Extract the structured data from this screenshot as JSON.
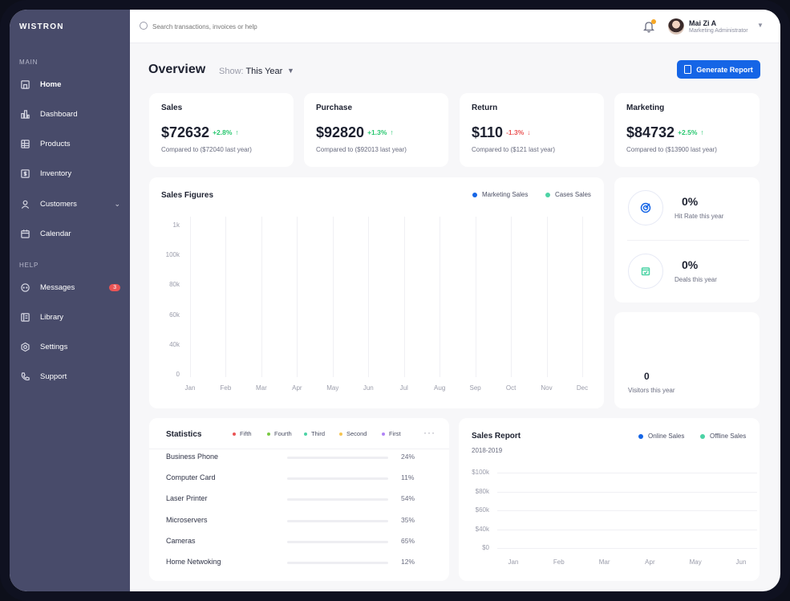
{
  "brand": "WISTRON",
  "sidebar": {
    "main_label": "MAIN",
    "help_label": "HELP",
    "main_items": [
      {
        "label": "Home",
        "icon": "home-icon"
      },
      {
        "label": "Dashboard",
        "icon": "bar-chart-icon"
      },
      {
        "label": "Products",
        "icon": "table-icon"
      },
      {
        "label": "Inventory",
        "icon": "dollar-doc-icon"
      },
      {
        "label": "Customers",
        "icon": "user-icon"
      },
      {
        "label": "Calendar",
        "icon": "calendar-icon"
      }
    ],
    "help_items": [
      {
        "label": "Messages",
        "icon": "chat-icon",
        "badge": "3"
      },
      {
        "label": "Library",
        "icon": "book-icon"
      },
      {
        "label": "Settings",
        "icon": "gear-icon"
      },
      {
        "label": "Support",
        "icon": "phone-icon"
      }
    ]
  },
  "topbar": {
    "search_placeholder": "Search transactions, invoices or help",
    "user_name": "Mai Zi A",
    "user_role": "Marketing Administrator"
  },
  "header": {
    "title": "Overview",
    "show_label": "Show:",
    "show_value": "This Year",
    "generate_button": "Generate Report"
  },
  "kpis": [
    {
      "title": "Sales",
      "value": "$72632",
      "delta": "+2.8%",
      "dir": "up",
      "sub": "Compared to ($72040 last year)"
    },
    {
      "title": "Purchase",
      "value": "$92820",
      "delta": "+1.3%",
      "dir": "up",
      "sub": "Compared to ($92013 last year)"
    },
    {
      "title": "Return",
      "value": "$110",
      "delta": "-1.3%",
      "dir": "down",
      "sub": "Compared to ($121 last year)"
    },
    {
      "title": "Marketing",
      "value": "$84732",
      "delta": "+2.5%",
      "dir": "up",
      "sub": "Compared to ($13900 last year)"
    }
  ],
  "sales_figures": {
    "title": "Sales Figures",
    "legend": [
      {
        "name": "Marketing Sales",
        "color": "#1565e6"
      },
      {
        "name": "Cases Sales",
        "color": "#4cd3a5"
      }
    ],
    "y_ticks": [
      "1k",
      "100k",
      "80k",
      "60k",
      "40k",
      "0"
    ],
    "x_ticks": [
      "Jan",
      "Feb",
      "Mar",
      "Apr",
      "May",
      "Jun",
      "Jul",
      "Aug",
      "Sep",
      "Oct",
      "Nov",
      "Dec"
    ]
  },
  "side_stats": {
    "hit_rate_value": "0%",
    "hit_rate_label": "Hit Rate this year",
    "deals_value": "0%",
    "deals_label": "Deals this year",
    "visitors_value": "0",
    "visitors_label": "Visitors this year"
  },
  "statistics": {
    "title": "Statistics",
    "legend": [
      {
        "name": "Fifth",
        "color": "#ea5455"
      },
      {
        "name": "Fourth",
        "color": "#7ac943"
      },
      {
        "name": "Third",
        "color": "#4cd3a5"
      },
      {
        "name": "Second",
        "color": "#f5c451"
      },
      {
        "name": "First",
        "color": "#b084f5"
      }
    ],
    "rows": [
      {
        "label": "Business Phone",
        "pct": "24%"
      },
      {
        "label": "Computer Card",
        "pct": "11%"
      },
      {
        "label": "Laser Printer",
        "pct": "54%"
      },
      {
        "label": "Microservers",
        "pct": "35%"
      },
      {
        "label": "Cameras",
        "pct": "65%"
      },
      {
        "label": "Home Netwoking",
        "pct": "12%"
      }
    ]
  },
  "sales_report": {
    "title": "Sales Report",
    "subtitle": "2018-2019",
    "legend": [
      {
        "name": "Online Sales",
        "color": "#1565e6"
      },
      {
        "name": "Offline Sales",
        "color": "#4cd3a5"
      }
    ],
    "y_ticks": [
      "$100k",
      "$80k",
      "$60k",
      "$40k",
      "$0"
    ],
    "x_ticks": [
      "Jan",
      "Feb",
      "Mar",
      "Apr",
      "May",
      "Jun"
    ]
  }
}
